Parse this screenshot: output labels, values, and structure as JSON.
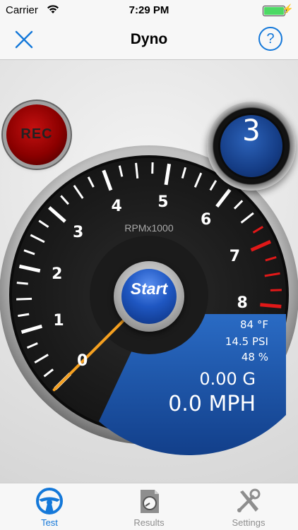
{
  "status_bar": {
    "carrier": "Carrier",
    "time": "7:29 PM"
  },
  "nav": {
    "title": "Dyno",
    "help_label": "?"
  },
  "controls": {
    "rec_label": "REC",
    "start_label": "Start",
    "gear": "3"
  },
  "gauge": {
    "unit_label": "RPMx1000",
    "numbers": [
      "0",
      "1",
      "2",
      "3",
      "4",
      "5",
      "6",
      "7",
      "8"
    ],
    "needle_value": 0
  },
  "readouts": {
    "temperature": "84 °F",
    "pressure": "14.5 PSI",
    "humidity": "48 %",
    "g_force": "0.00 G",
    "speed": "0.0 MPH"
  },
  "tabs": [
    {
      "label": "Test",
      "icon": "steering-wheel-icon",
      "active": true
    },
    {
      "label": "Results",
      "icon": "dyno-results-icon",
      "active": false
    },
    {
      "label": "Settings",
      "icon": "tools-icon",
      "active": false
    }
  ],
  "colors": {
    "accent": "#1478d9",
    "readout_panel": "#1d5fb8",
    "needle": "#f5a020",
    "redline": "#e01818"
  }
}
